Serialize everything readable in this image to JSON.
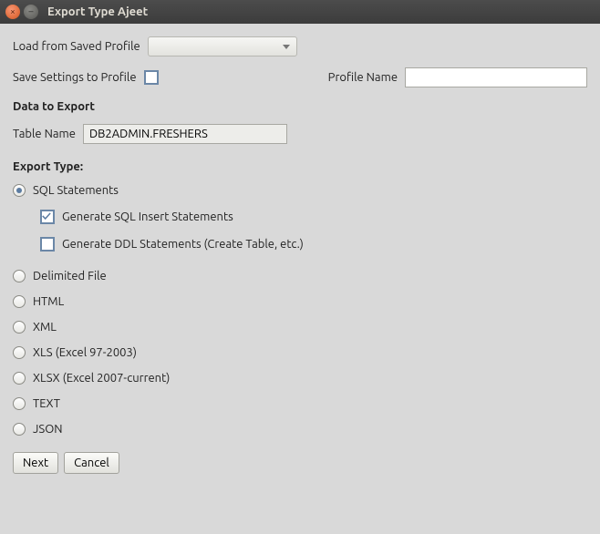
{
  "window": {
    "title": "Export Type Ajeet"
  },
  "profile": {
    "load_label": "Load from Saved Profile",
    "save_label": "Save Settings to Profile",
    "save_checked": false,
    "name_label": "Profile Name",
    "name_value": ""
  },
  "data_export": {
    "heading": "Data to Export",
    "table_label": "Table Name",
    "table_value": "DB2ADMIN.FRESHERS"
  },
  "export_type": {
    "heading": "Export Type:",
    "selected": "sql",
    "options": {
      "sql": {
        "label": "SQL Statements",
        "sub": {
          "insert": {
            "label": "Generate SQL Insert Statements",
            "checked": true
          },
          "ddl": {
            "label": "Generate DDL Statements (Create Table, etc.)",
            "checked": false
          }
        }
      },
      "delimited": {
        "label": "Delimited File"
      },
      "html": {
        "label": "HTML"
      },
      "xml": {
        "label": "XML"
      },
      "xls": {
        "label": "XLS (Excel 97-2003)"
      },
      "xlsx": {
        "label": "XLSX (Excel 2007-current)"
      },
      "text": {
        "label": "TEXT"
      },
      "json": {
        "label": "JSON"
      }
    }
  },
  "buttons": {
    "next": "Next",
    "cancel": "Cancel"
  }
}
